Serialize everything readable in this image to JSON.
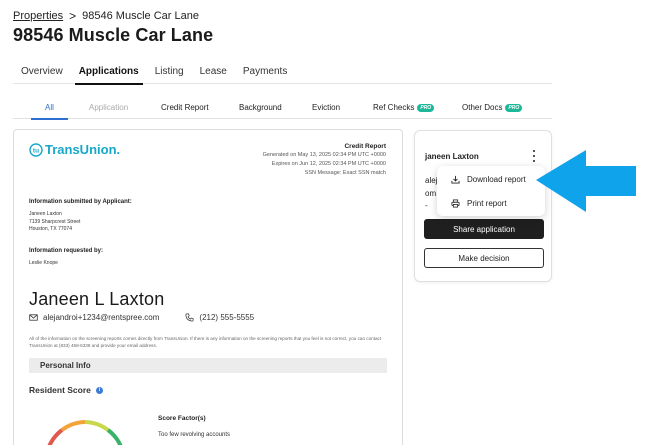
{
  "breadcrumb": {
    "parent": "Properties",
    "separator": ">",
    "current": "98546 Muscle Car Lane"
  },
  "page": {
    "title": "98546 Muscle Car Lane"
  },
  "main_tabs": [
    {
      "label": "Overview",
      "active": false
    },
    {
      "label": "Applications",
      "active": true
    },
    {
      "label": "Listing",
      "active": false
    },
    {
      "label": "Lease",
      "active": false
    },
    {
      "label": "Payments",
      "active": false
    }
  ],
  "sub_tabs": [
    {
      "label": "All",
      "active": true
    },
    {
      "label": "Application",
      "muted": true
    },
    {
      "label": "Credit Report"
    },
    {
      "label": "Background"
    },
    {
      "label": "Eviction"
    },
    {
      "label": "Ref Checks",
      "badge": "PRO"
    },
    {
      "label": "Other Docs",
      "badge": "PRO"
    }
  ],
  "report": {
    "logo_text": "TransUnion.",
    "meta_title": "Credit Report",
    "generated": "Generated on May 13, 2025 02:34 PM UTC +0000",
    "expires": "Expires on Jun 12, 2025 02:34 PM UTC +0000",
    "ssn_message": "SSN Message: Exact SSN match",
    "submitted_heading": "Information submitted by Applicant:",
    "submitted_name": "Janeen Laxton",
    "submitted_street": "7139 Sharpcrest Street",
    "submitted_city": "Houston, TX 77074",
    "requested_heading": "Information requested by:",
    "requested_name": "Leslie Knope",
    "applicant_name": "Janeen L Laxton",
    "email": "alejandroi+1234@rentspree.com",
    "phone": "(212) 555-5555",
    "disclaimer": "All of the information on the screening reports comes directly from TransUnion. If there is any information on the screening reports that you feel is not correct, you can contact TransUnion at (833) 458-6338 and provide your email address.",
    "section_personal": "Personal Info",
    "resident_score_label": "Resident Score",
    "info_glyph": "i",
    "score_factors_title": "Score Factor(s)",
    "score_factor_1": "Too few revolving accounts"
  },
  "side_card": {
    "name": "janeen Laxton",
    "line_1": "alej",
    "line_2": "om",
    "line_3": "-",
    "share_label": "Share application",
    "decision_label": "Make decision"
  },
  "dropdown": {
    "download_label": "Download report",
    "print_label": "Print report"
  },
  "colors": {
    "accent_blue": "#2f6fd0",
    "arrow_blue": "#0fa3ec",
    "pro_green": "#1db89a",
    "transunion": "#17a8c9"
  },
  "icons": [
    "chevron-right-icon",
    "transunion-logo-icon",
    "mail-icon",
    "phone-icon",
    "info-icon",
    "kebab-menu-icon",
    "download-icon",
    "print-icon",
    "pointer-arrow-icon"
  ]
}
